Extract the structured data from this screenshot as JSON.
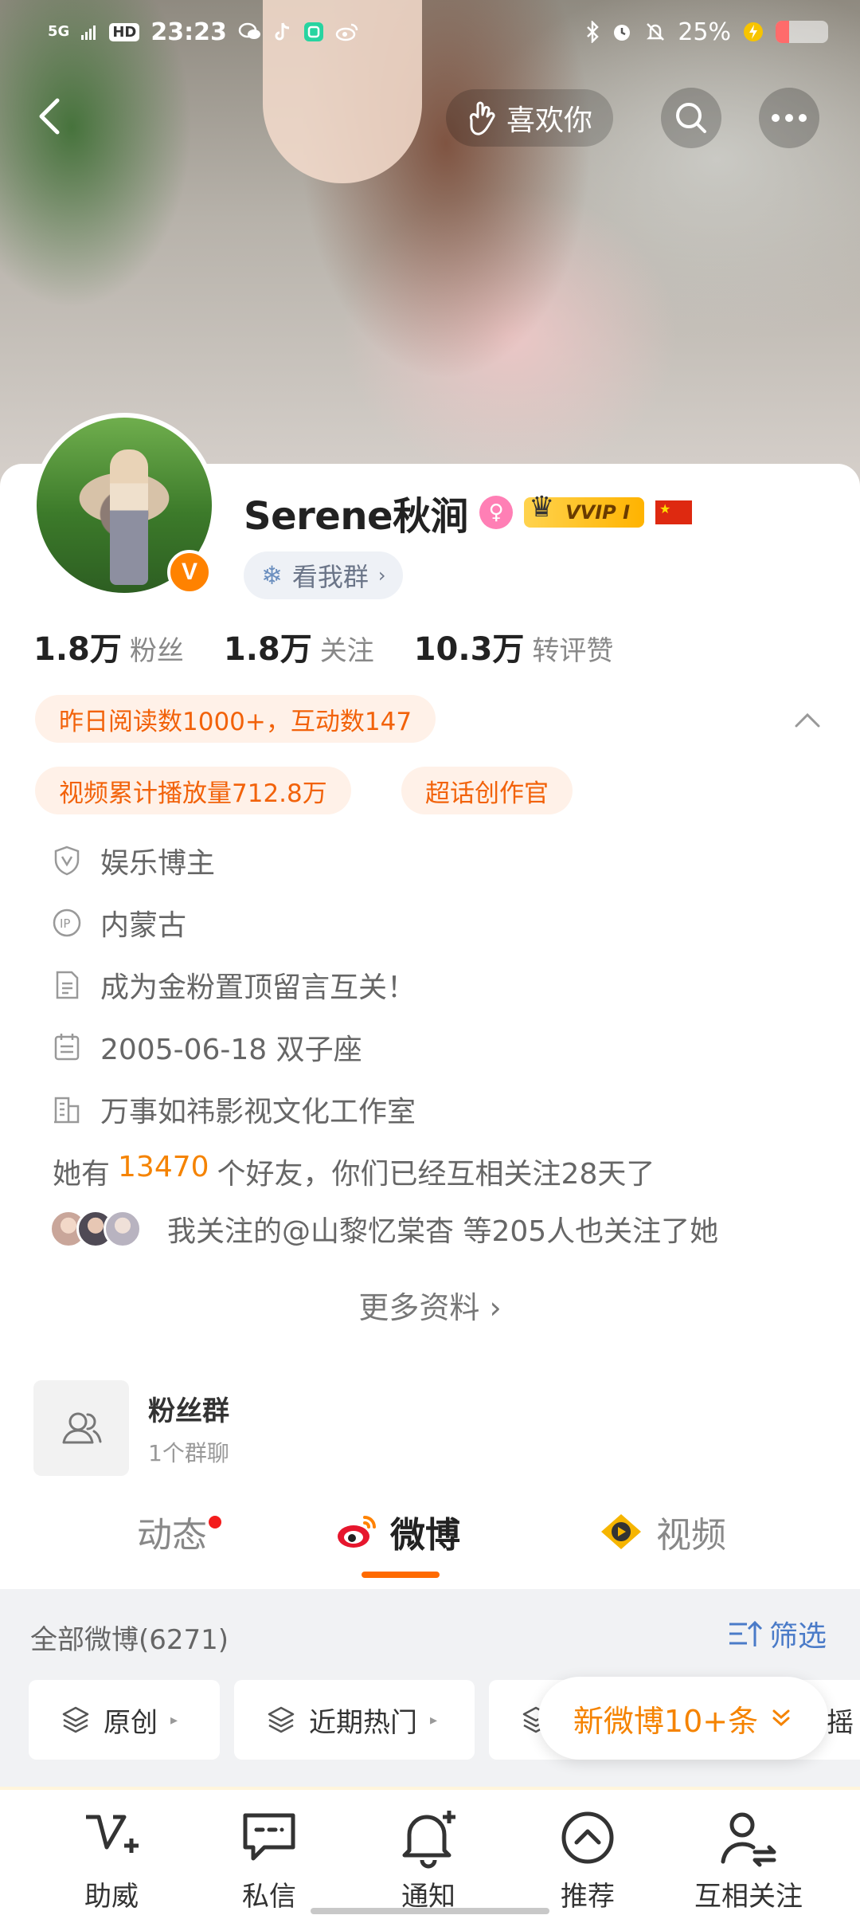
{
  "status_bar": {
    "network": "5G",
    "hd": "HD",
    "time": "23:23",
    "battery": "25%",
    "battery_level": 0.25
  },
  "nav": {
    "like_label": "喜欢你"
  },
  "profile": {
    "name": "Serene秋涧",
    "vip_label": "VVIP I",
    "vip_badge_letter": "V",
    "group_chip": "看我群",
    "stats": [
      {
        "value": "1.8万",
        "label": "粉丝"
      },
      {
        "value": "1.8万",
        "label": "关注"
      },
      {
        "value": "10.3万",
        "label": "转评赞"
      }
    ],
    "tags": {
      "read": "昨日阅读数1000+，互动数147",
      "play": "视频累计播放量712.8万",
      "super": "超话创作官"
    },
    "info": [
      {
        "icon": "shield-v-icon",
        "text": "娱乐博主"
      },
      {
        "icon": "ip-icon",
        "text": "内蒙古"
      },
      {
        "icon": "document-icon",
        "text": "成为金粉置顶留言互关！"
      },
      {
        "icon": "calendar-icon",
        "text": "2005-06-18 双子座"
      },
      {
        "icon": "company-icon",
        "text": "万事如祎影视文化工作室"
      }
    ],
    "friends": {
      "prefix": "她有",
      "count": "13470",
      "suffix": "个好友，你们已经互相关注28天了"
    },
    "mutual_text": "我关注的@山黎忆棠杳 等205人也关注了她",
    "more_info": "更多资料"
  },
  "fan_group": {
    "title": "粉丝群",
    "subtitle": "1个群聊"
  },
  "tabs": [
    {
      "label": "动态"
    },
    {
      "label": "微博"
    },
    {
      "label": "视频"
    }
  ],
  "feed": {
    "header": "全部微博(6271)",
    "filter": "筛选",
    "chips": [
      "原创",
      "近期热门"
    ],
    "chip_tail": "摇",
    "new_weibo": "新微博10+条"
  },
  "bottom_nav": [
    {
      "label": "助威"
    },
    {
      "label": "私信"
    },
    {
      "label": "通知"
    },
    {
      "label": "推荐"
    },
    {
      "label": "互相关注"
    }
  ],
  "colors": {
    "accent": "#ff8200",
    "link": "#4a7bc8",
    "tag_text": "#f2620a"
  }
}
